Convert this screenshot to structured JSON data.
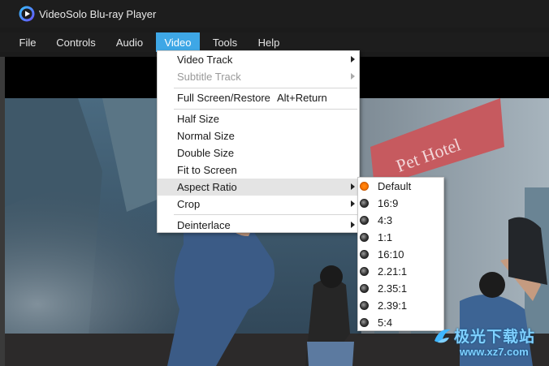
{
  "window": {
    "title": "VideoSolo Blu-ray Player"
  },
  "menubar": {
    "items": [
      {
        "label": "File"
      },
      {
        "label": "Controls"
      },
      {
        "label": "Audio"
      },
      {
        "label": "Video"
      },
      {
        "label": "Tools"
      },
      {
        "label": "Help"
      }
    ],
    "active": "Video"
  },
  "video_menu": {
    "items": [
      {
        "label": "Video Track",
        "submenu": true,
        "enabled": true
      },
      {
        "label": "Subtitle Track",
        "submenu": true,
        "enabled": false
      },
      {
        "label": "Full Screen/Restore",
        "shortcut": "Alt+Return",
        "enabled": true
      },
      {
        "label": "Half Size",
        "enabled": true
      },
      {
        "label": "Normal Size",
        "enabled": true
      },
      {
        "label": "Double Size",
        "enabled": true
      },
      {
        "label": "Fit to Screen",
        "enabled": true
      },
      {
        "label": "Aspect Ratio",
        "submenu": true,
        "enabled": true,
        "highlighted": true
      },
      {
        "label": "Crop",
        "submenu": true,
        "enabled": true
      },
      {
        "label": "Deinterlace",
        "submenu": true,
        "enabled": true
      }
    ]
  },
  "aspect_ratio_menu": {
    "selected": "Default",
    "options": [
      "Default",
      "16:9",
      "4:3",
      "1:1",
      "16:10",
      "2.21:1",
      "2.35:1",
      "2.39:1",
      "5:4"
    ]
  },
  "video_content": {
    "sign_text": "Pet Hotel"
  },
  "watermark": {
    "cn": "极光下载站",
    "url": "www.xz7.com"
  },
  "colors": {
    "accent": "#3ea7e6",
    "radio_selected": "#ff7a00",
    "menu_bg": "#ffffff",
    "highlight": "#e4e4e4"
  }
}
